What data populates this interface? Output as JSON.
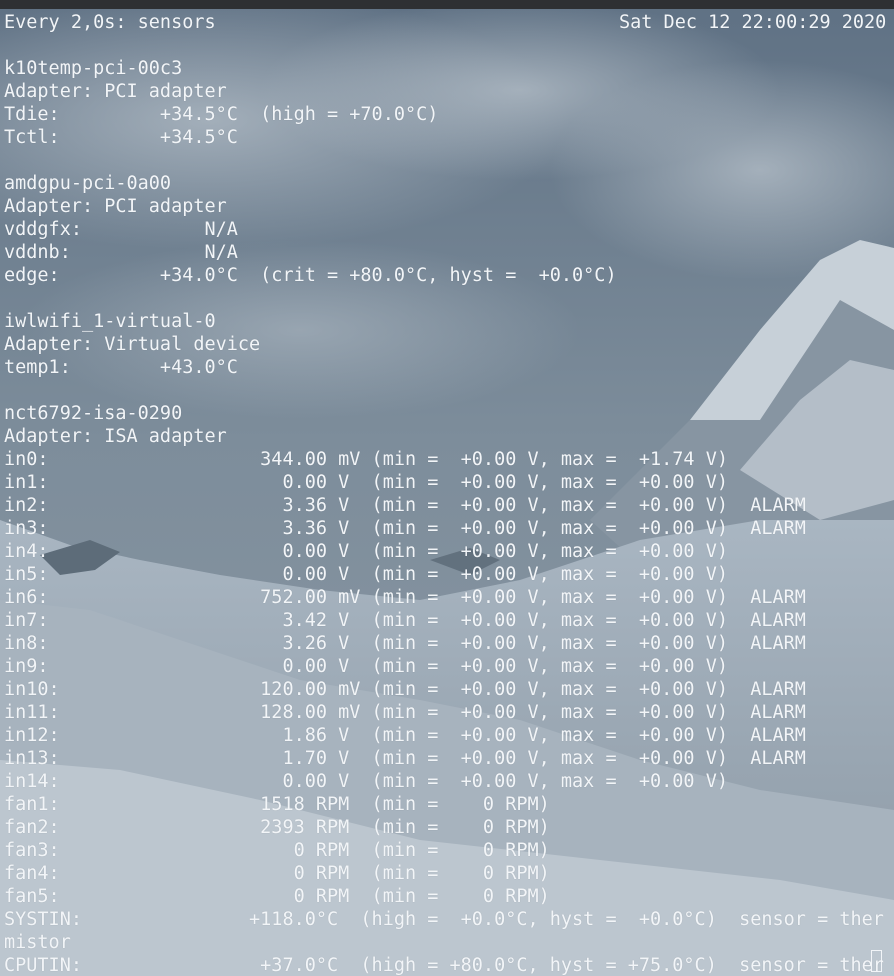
{
  "header": {
    "command": "Every 2,0s: sensors",
    "timestamp": "Sat Dec 12 22:00:29 2020"
  },
  "output": [
    "",
    "k10temp-pci-00c3",
    "Adapter: PCI adapter",
    "Tdie:         +34.5°C  (high = +70.0°C)",
    "Tctl:         +34.5°C",
    "",
    "amdgpu-pci-0a00",
    "Adapter: PCI adapter",
    "vddgfx:           N/A",
    "vddnb:            N/A",
    "edge:         +34.0°C  (crit = +80.0°C, hyst =  +0.0°C)",
    "",
    "iwlwifi_1-virtual-0",
    "Adapter: Virtual device",
    "temp1:        +43.0°C",
    "",
    "nct6792-isa-0290",
    "Adapter: ISA adapter",
    "in0:                   344.00 mV (min =  +0.00 V, max =  +1.74 V)",
    "in1:                     0.00 V  (min =  +0.00 V, max =  +0.00 V)",
    "in2:                     3.36 V  (min =  +0.00 V, max =  +0.00 V)  ALARM",
    "in3:                     3.36 V  (min =  +0.00 V, max =  +0.00 V)  ALARM",
    "in4:                     0.00 V  (min =  +0.00 V, max =  +0.00 V)",
    "in5:                     0.00 V  (min =  +0.00 V, max =  +0.00 V)",
    "in6:                   752.00 mV (min =  +0.00 V, max =  +0.00 V)  ALARM",
    "in7:                     3.42 V  (min =  +0.00 V, max =  +0.00 V)  ALARM",
    "in8:                     3.26 V  (min =  +0.00 V, max =  +0.00 V)  ALARM",
    "in9:                     0.00 V  (min =  +0.00 V, max =  +0.00 V)",
    "in10:                  120.00 mV (min =  +0.00 V, max =  +0.00 V)  ALARM",
    "in11:                  128.00 mV (min =  +0.00 V, max =  +0.00 V)  ALARM",
    "in12:                    1.86 V  (min =  +0.00 V, max =  +0.00 V)  ALARM",
    "in13:                    1.70 V  (min =  +0.00 V, max =  +0.00 V)  ALARM",
    "in14:                    0.00 V  (min =  +0.00 V, max =  +0.00 V)",
    "fan1:                  1518 RPM  (min =    0 RPM)",
    "fan2:                  2393 RPM  (min =    0 RPM)",
    "fan3:                     0 RPM  (min =    0 RPM)",
    "fan4:                     0 RPM  (min =    0 RPM)",
    "fan5:                     0 RPM  (min =    0 RPM)",
    "SYSTIN:               +118.0°C  (high =  +0.0°C, hyst =  +0.0°C)  sensor = ther",
    "mistor",
    "CPUTIN:                +37.0°C  (high = +80.0°C, hyst = +75.0°C)  sensor = ther"
  ],
  "colors": {
    "text": "#f2f5f8",
    "titlebar": "#2e3033",
    "sky": "#6f8090",
    "snow": "#d8dee4"
  }
}
